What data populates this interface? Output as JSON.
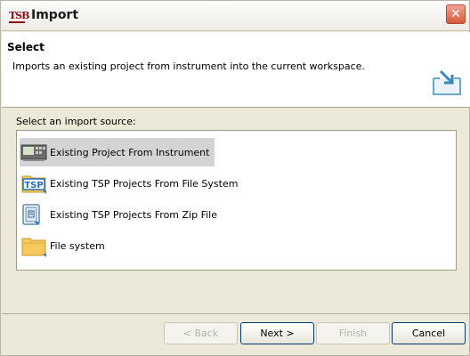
{
  "window": {
    "title": "Import",
    "app_icon_text": "TSB",
    "close_glyph": "✕"
  },
  "header": {
    "title": "Select",
    "description": "Imports an existing project from instrument into the current workspace."
  },
  "source": {
    "label": "Select an import source:",
    "items": [
      {
        "label": "Existing Project From Instrument",
        "icon": "instrument-icon",
        "selected": true
      },
      {
        "label": "Existing TSP Projects From File System",
        "icon": "tsp-folder-icon",
        "icon_text": "TSP",
        "selected": false
      },
      {
        "label": "Existing TSP Projects From Zip File",
        "icon": "zip-file-icon",
        "selected": false
      },
      {
        "label": "File system",
        "icon": "folder-icon",
        "selected": false
      }
    ]
  },
  "buttons": {
    "back": "< Back",
    "next": "Next >",
    "finish": "Finish",
    "cancel": "Cancel"
  },
  "colors": {
    "dialog_bg": "#ece9d8",
    "selection_bg": "#d4d4d4",
    "close_red": "#d6593d",
    "folder_yellow": "#f7c85d",
    "tsp_blue": "#1f6fb8"
  }
}
